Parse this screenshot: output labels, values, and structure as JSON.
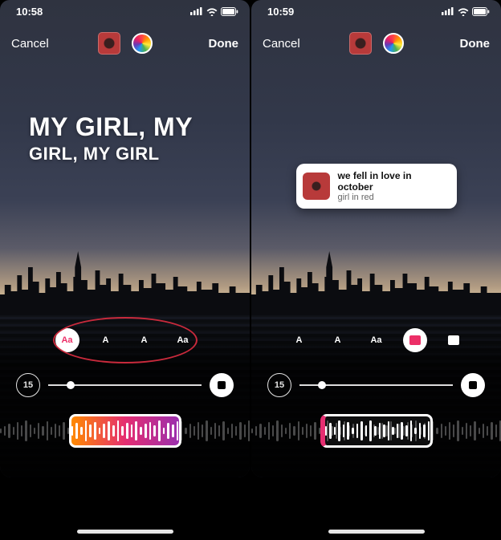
{
  "screens": [
    {
      "status_time": "10:58",
      "topbar": {
        "cancel": "Cancel",
        "done": "Done"
      },
      "lyrics": {
        "line1": "MY GIRL, MY",
        "line2": "GIRL, MY GIRL"
      },
      "styles": [
        "Aa",
        "A",
        "A",
        "Aa"
      ],
      "active_style_index": 0,
      "duration": "15",
      "annotation_circle": true,
      "clip_style": "gradient"
    },
    {
      "status_time": "10:59",
      "topbar": {
        "cancel": "Cancel",
        "done": "Done"
      },
      "song": {
        "title": "we fell in love in october",
        "artist": "girl in red"
      },
      "styles": [
        "A",
        "A",
        "Aa",
        "▮",
        "▯"
      ],
      "active_style_index": 3,
      "duration": "15",
      "annotation_circle": false,
      "clip_style": "plain"
    }
  ]
}
